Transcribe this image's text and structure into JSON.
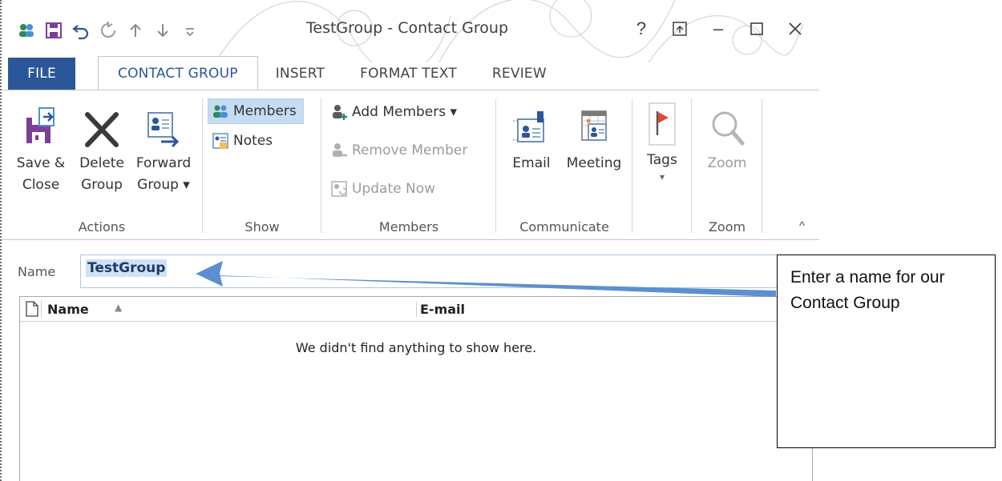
{
  "window": {
    "title": "TestGroup - Contact Group",
    "help": "?",
    "minimize": "–"
  },
  "tabs": [
    {
      "label": "FILE"
    },
    {
      "label": "CONTACT GROUP"
    },
    {
      "label": "INSERT"
    },
    {
      "label": "FORMAT TEXT"
    },
    {
      "label": "REVIEW"
    }
  ],
  "ribbon": {
    "actions": {
      "label": "Actions",
      "save": "Save &\nClose",
      "delete": "Delete\nGroup",
      "forward": "Forward\nGroup ▾"
    },
    "show": {
      "label": "Show",
      "members": "Members",
      "notes": "Notes"
    },
    "members": {
      "label": "Members",
      "add": "Add Members ▾",
      "remove": "Remove Member",
      "update": "Update Now"
    },
    "communicate": {
      "label": "Communicate",
      "email": "Email",
      "meeting": "Meeting"
    },
    "tags": {
      "label": "Tags",
      "arrow": "▾"
    },
    "zoom": {
      "label": "Zoom",
      "button": "Zoom"
    },
    "collapse": "^"
  },
  "form": {
    "name_label": "Name",
    "name_value": "TestGroup"
  },
  "list": {
    "columns": [
      "Name",
      "E-mail"
    ],
    "sort_indicator": "▲",
    "empty_message": "We didn't find anything to show here."
  },
  "callout": {
    "text": "Enter a name for our Contact Group"
  },
  "colors": {
    "accent": "#2b579a",
    "arrow": "#5b8fd0",
    "tag_flag": "#e04a2f"
  }
}
